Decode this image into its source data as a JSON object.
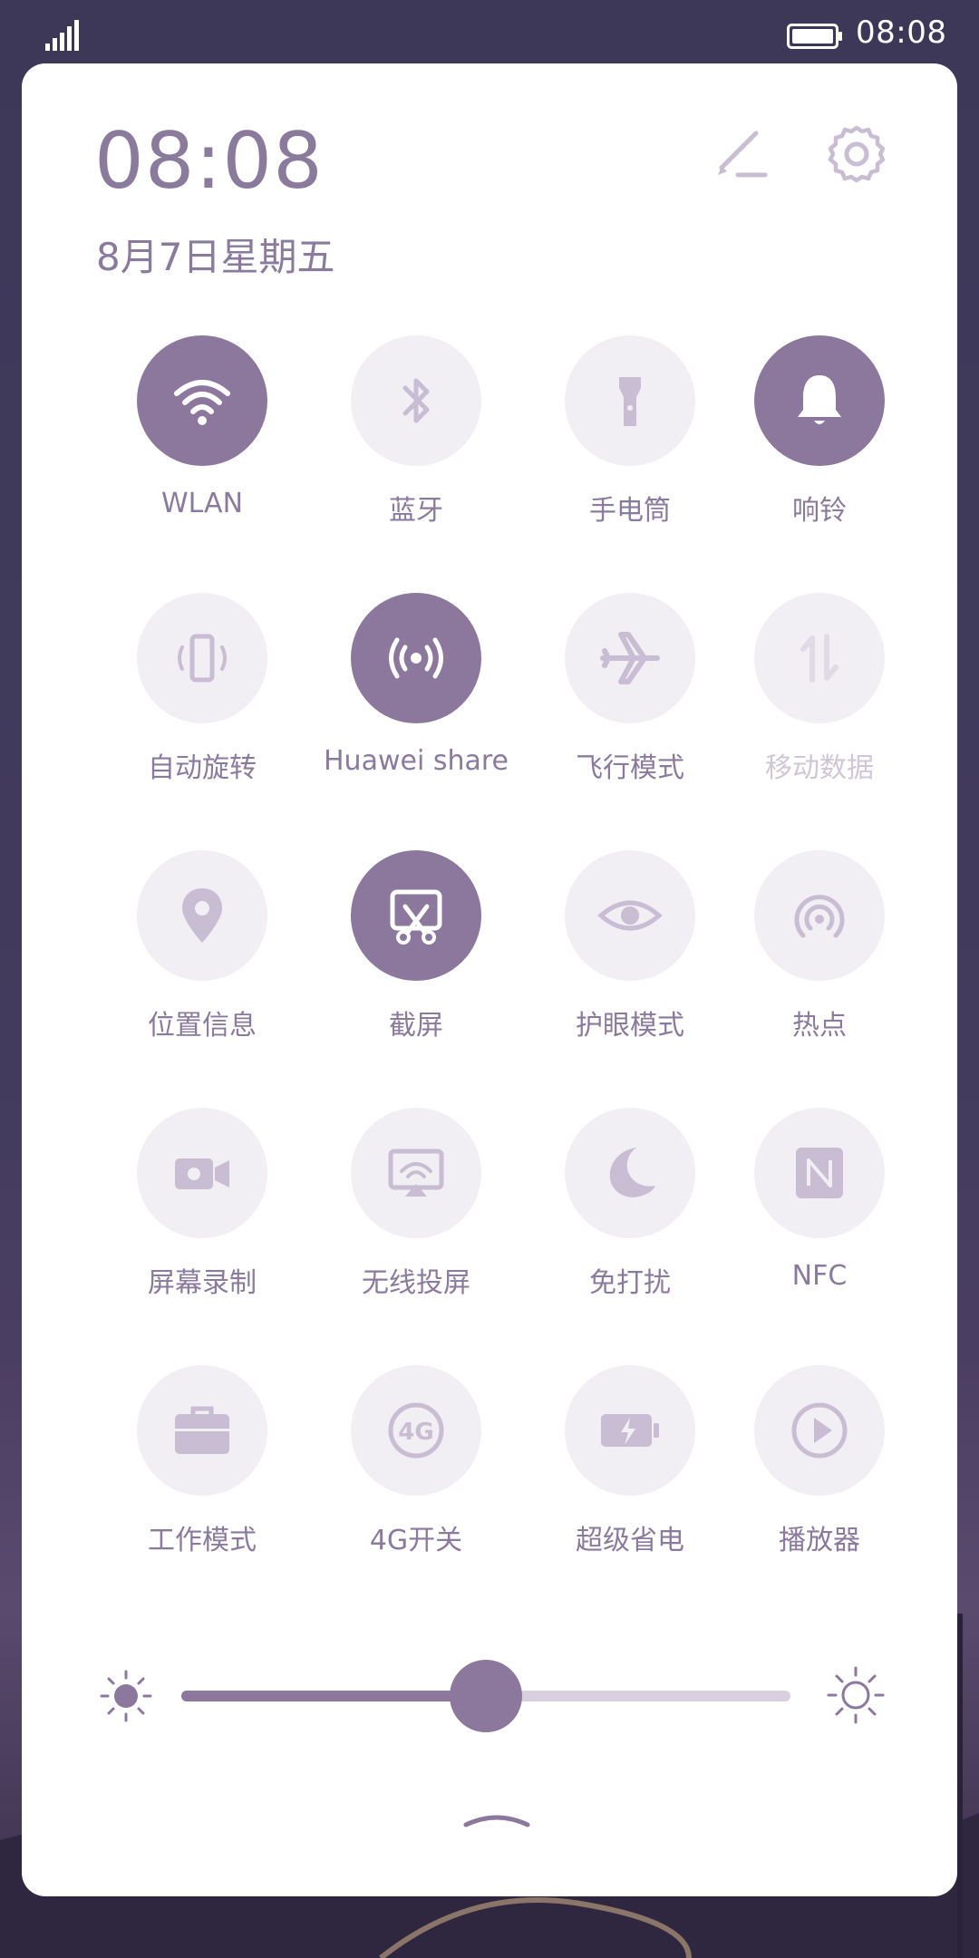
{
  "status_bar": {
    "time": "08:08"
  },
  "panel": {
    "time": "08:08",
    "date": "8月7日星期五"
  },
  "tiles": [
    {
      "label": "WLAN",
      "icon": "wifi-icon",
      "state": "on"
    },
    {
      "label": "蓝牙",
      "icon": "bluetooth-icon",
      "state": "off"
    },
    {
      "label": "手电筒",
      "icon": "flashlight-icon",
      "state": "off"
    },
    {
      "label": "响铃",
      "icon": "bell-icon",
      "state": "on"
    },
    {
      "label": "自动旋转",
      "icon": "auto-rotate-icon",
      "state": "off"
    },
    {
      "label": "Huawei share",
      "icon": "huawei-share-icon",
      "state": "on"
    },
    {
      "label": "飞行模式",
      "icon": "airplane-icon",
      "state": "off"
    },
    {
      "label": "移动数据",
      "icon": "mobile-data-icon",
      "state": "disabled"
    },
    {
      "label": "位置信息",
      "icon": "location-icon",
      "state": "off"
    },
    {
      "label": "截屏",
      "icon": "screenshot-icon",
      "state": "on"
    },
    {
      "label": "护眼模式",
      "icon": "eye-icon",
      "state": "off"
    },
    {
      "label": "热点",
      "icon": "hotspot-icon",
      "state": "off"
    },
    {
      "label": "屏幕录制",
      "icon": "screen-record-icon",
      "state": "off"
    },
    {
      "label": "无线投屏",
      "icon": "wireless-projection-icon",
      "state": "off"
    },
    {
      "label": "免打扰",
      "icon": "moon-icon",
      "state": "off"
    },
    {
      "label": "NFC",
      "icon": "nfc-icon",
      "state": "off"
    },
    {
      "label": "工作模式",
      "icon": "briefcase-icon",
      "state": "off"
    },
    {
      "label": "4G开关",
      "icon": "4g-icon",
      "state": "off"
    },
    {
      "label": "超级省电",
      "icon": "battery-saver-icon",
      "state": "off"
    },
    {
      "label": "播放器",
      "icon": "play-icon",
      "state": "off"
    }
  ],
  "brightness": {
    "level": 0.5
  },
  "colors": {
    "accent": "#8b789c",
    "tile_off": "#f1eef4",
    "icon_off": "#c8bdd2",
    "text": "#8a7a9c"
  }
}
